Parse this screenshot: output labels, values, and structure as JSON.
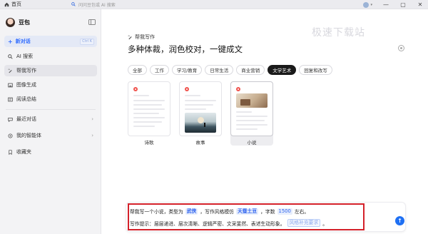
{
  "titlebar": {
    "home_label": "首页",
    "search_placeholder": "问问豆包或 AI 搜索",
    "avatar_chevron": "▾",
    "minimize": "—",
    "maximize": "▢",
    "close": "✕"
  },
  "sidebar": {
    "brand": "豆包",
    "new_chat": "新对话",
    "new_chat_shortcut": "Ctrl K",
    "items": [
      {
        "label": "AI 搜索",
        "icon": "search-icon"
      },
      {
        "label": "帮我写作",
        "icon": "pen-icon"
      },
      {
        "label": "图像生成",
        "icon": "image-icon"
      },
      {
        "label": "阅读总结",
        "icon": "book-icon"
      }
    ],
    "sections": [
      {
        "label": "最近对话",
        "icon": "chat-icon"
      },
      {
        "label": "我的智能体",
        "icon": "agent-icon"
      },
      {
        "label": "收藏夹",
        "icon": "bookmark-icon"
      }
    ]
  },
  "main": {
    "feature_title": "帮我写作",
    "headline": "多种体裁，润色校对，一键成文",
    "watermark": "极速下载站",
    "tabs": [
      "全部",
      "工作",
      "学习/教育",
      "日常生活",
      "商业营销",
      "文学艺术",
      "回复和改写"
    ],
    "active_tab": "文学艺术",
    "cards": [
      {
        "label": "诗歌",
        "has_image": false
      },
      {
        "label": "故事",
        "has_image": true
      },
      {
        "label": "小说",
        "has_image": true
      }
    ],
    "selected_card": "小说"
  },
  "prompt": {
    "line1_a": "帮我写一个小说，类型为",
    "genre": "武侠",
    "line1_b": "，写作风格模仿",
    "style": "天蚕土豆",
    "line1_c": "，字数",
    "count": "1500",
    "line1_d": "左右。",
    "line2_a": "写作提示：层层递进、层次清晰、逻辑严密、文采斐然、表述生动形象。",
    "supplement": "风格补充要求",
    "line2_end": "。",
    "send": "↑"
  },
  "colors": {
    "accent": "#2f6bff",
    "highlight_box": "#d4212a",
    "active_tab": "#1a1a1a"
  }
}
